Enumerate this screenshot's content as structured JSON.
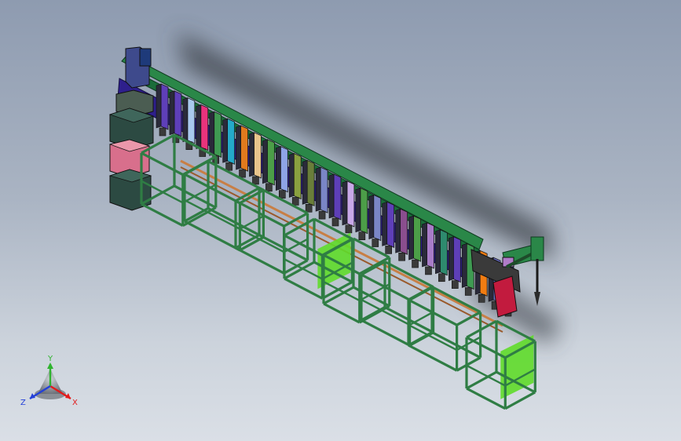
{
  "model": {
    "name": "",
    "rack_color": "#2f7d44",
    "rail_color": "#c87f45",
    "stations": [
      {
        "color": "#5e3fb8"
      },
      {
        "color": "#5e3fb8"
      },
      {
        "color": "#a9c9ee"
      },
      {
        "color": "#e8337c"
      },
      {
        "color": "#3f9a52"
      },
      {
        "color": "#24a9c8"
      },
      {
        "color": "#e07a1e"
      },
      {
        "color": "#e8c48c"
      },
      {
        "color": "#4c9e48"
      },
      {
        "color": "#8ea4e6"
      },
      {
        "color": "#8aa040"
      },
      {
        "color": "#6a7e3a"
      },
      {
        "color": "#7a86c6"
      },
      {
        "color": "#5e3fb8"
      },
      {
        "color": "#c8a8e8"
      },
      {
        "color": "#4c9e48"
      },
      {
        "color": "#7a86c6"
      },
      {
        "color": "#5e3fb8"
      },
      {
        "color": "#8a4e8e"
      },
      {
        "color": "#4c9e48"
      },
      {
        "color": "#a87cc8"
      },
      {
        "color": "#2e8a6e"
      },
      {
        "color": "#5e3fb8"
      },
      {
        "color": "#3f9a52"
      },
      {
        "color": "#f07c12"
      },
      {
        "color": "#6a6ec6"
      },
      {
        "color": "#2f7de2"
      }
    ]
  },
  "triad": {
    "x_label": "X",
    "y_label": "Y",
    "z_label": "Z",
    "x_color": "#e21b1b",
    "y_color": "#2fb32f",
    "z_color": "#2340d8"
  }
}
